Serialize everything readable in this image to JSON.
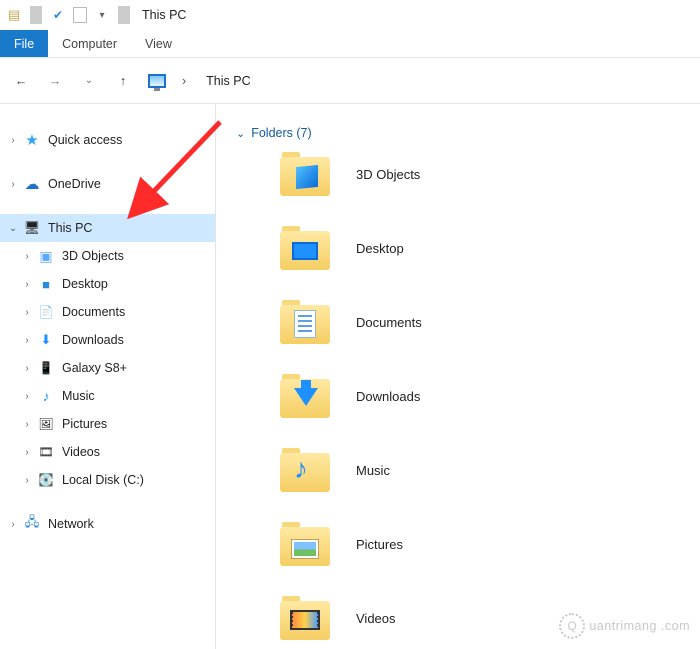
{
  "titlebar": {
    "title": "This PC"
  },
  "ribbon": {
    "file": "File",
    "computer": "Computer",
    "view": "View"
  },
  "nav": {
    "address_label": "This PC"
  },
  "sidebar": {
    "quick_access": "Quick access",
    "onedrive": "OneDrive",
    "this_pc": "This PC",
    "children": {
      "c0": "3D Objects",
      "c1": "Desktop",
      "c2": "Documents",
      "c3": "Downloads",
      "c4": "Galaxy S8+",
      "c5": "Music",
      "c6": "Pictures",
      "c7": "Videos",
      "c8": "Local Disk (C:)"
    },
    "network": "Network"
  },
  "content": {
    "section_label": "Folders (7)",
    "folders": {
      "f0": "3D Objects",
      "f1": "Desktop",
      "f2": "Documents",
      "f3": "Downloads",
      "f4": "Music",
      "f5": "Pictures",
      "f6": "Videos"
    }
  },
  "watermark": {
    "text": "uantrimang"
  }
}
